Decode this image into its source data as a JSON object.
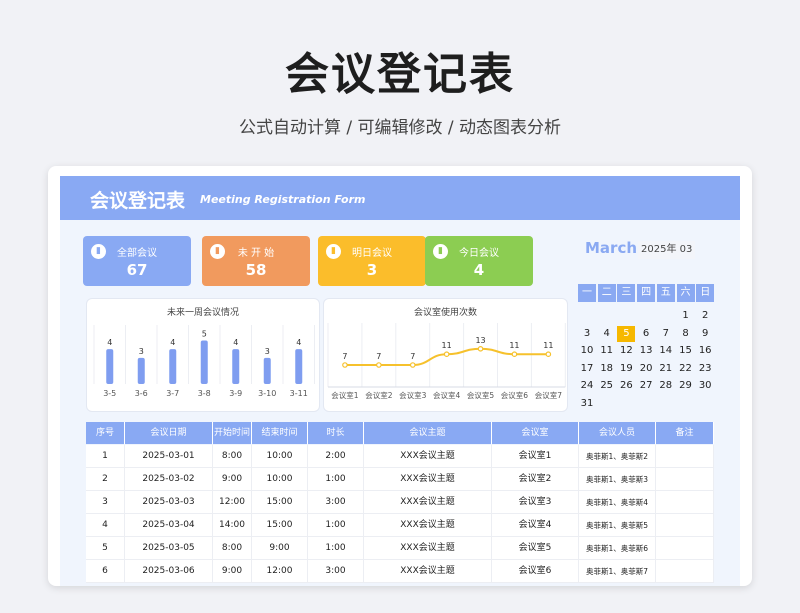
{
  "hero": {
    "title": "会议登记表",
    "subtitle": "公式自动计算 /  可编辑修改  / 动态图表分析"
  },
  "banner": {
    "title": "会议登记表",
    "title_en": "Meeting Registration Form"
  },
  "stats": [
    {
      "label": "全部会议",
      "value": "67",
      "color": "#89a9f3"
    },
    {
      "label": "未 开 始",
      "value": "58",
      "color": "#f19a5e"
    },
    {
      "label": "明日会议",
      "value": "3",
      "color": "#fbbd2b"
    },
    {
      "label": "今日会议",
      "value": "4",
      "color": "#8ccd52"
    }
  ],
  "weekly_chart": {
    "title": "未来一周会议情况",
    "chart_data": {
      "type": "bar",
      "categories": [
        "3-5",
        "3-6",
        "3-7",
        "3-8",
        "3-9",
        "3-10",
        "3-11"
      ],
      "values": [
        4,
        3,
        4,
        5,
        4,
        3,
        4
      ],
      "ylim": [
        0,
        6
      ]
    }
  },
  "room_chart": {
    "title": "会议室使用次数",
    "chart_data": {
      "type": "line",
      "categories": [
        "会议室1",
        "会议室2",
        "会议室3",
        "会议室4",
        "会议室5",
        "会议室6",
        "会议室7"
      ],
      "values": [
        7,
        7,
        7,
        11,
        13,
        11,
        11
      ],
      "ylim": [
        0,
        16
      ]
    }
  },
  "calendar": {
    "month": "March",
    "year": "2025年",
    "month_num": "03",
    "weekdays": [
      "一",
      "二",
      "三",
      "四",
      "五",
      "六",
      "日"
    ],
    "today": "5",
    "rows": [
      [
        "",
        "",
        "",
        "",
        "",
        "1",
        "2"
      ],
      [
        "3",
        "4",
        "5",
        "6",
        "7",
        "8",
        "9"
      ],
      [
        "10",
        "11",
        "12",
        "13",
        "14",
        "15",
        "16"
      ],
      [
        "17",
        "18",
        "19",
        "20",
        "21",
        "22",
        "23"
      ],
      [
        "24",
        "25",
        "26",
        "27",
        "28",
        "29",
        "30"
      ],
      [
        "31",
        "",
        "",
        "",
        "",
        "",
        ""
      ]
    ]
  },
  "table": {
    "headers": [
      "序号",
      "会议日期",
      "开始时间",
      "结束时间",
      "时长",
      "会议主题",
      "会议室",
      "会议人员",
      "备注"
    ],
    "rows": [
      [
        "1",
        "2025-03-01",
        "8:00",
        "10:00",
        "2:00",
        "XXX会议主题",
        "会议室1",
        "奥菲斯1、奥菲斯2",
        ""
      ],
      [
        "2",
        "2025-03-02",
        "9:00",
        "10:00",
        "1:00",
        "XXX会议主题",
        "会议室2",
        "奥菲斯1、奥菲斯3",
        ""
      ],
      [
        "3",
        "2025-03-03",
        "12:00",
        "15:00",
        "3:00",
        "XXX会议主题",
        "会议室3",
        "奥菲斯1、奥菲斯4",
        ""
      ],
      [
        "4",
        "2025-03-04",
        "14:00",
        "15:00",
        "1:00",
        "XXX会议主题",
        "会议室4",
        "奥菲斯1、奥菲斯5",
        ""
      ],
      [
        "5",
        "2025-03-05",
        "8:00",
        "9:00",
        "1:00",
        "XXX会议主题",
        "会议室5",
        "奥菲斯1、奥菲斯6",
        ""
      ],
      [
        "6",
        "2025-03-06",
        "9:00",
        "12:00",
        "3:00",
        "XXX会议主题",
        "会议室6",
        "奥菲斯1、奥菲斯7",
        ""
      ]
    ]
  }
}
